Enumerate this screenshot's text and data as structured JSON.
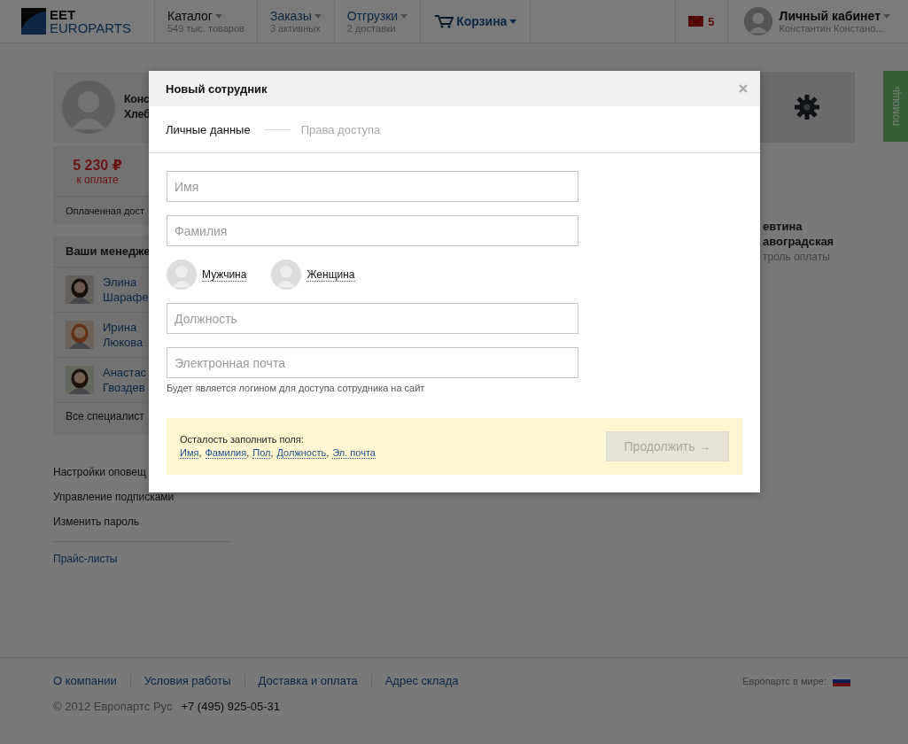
{
  "header": {
    "logo": {
      "top": "EET",
      "bottom": "EUROPARTS"
    },
    "nav": [
      {
        "kind": "menu",
        "label": "Каталог",
        "sub": "549 тыс. товаров",
        "accent": false
      },
      {
        "kind": "menu",
        "label": "Заказы",
        "sub": "3 активных",
        "accent": true
      },
      {
        "kind": "menu",
        "label": "Отгрузки",
        "sub": "2 доставки",
        "accent": true
      },
      {
        "kind": "cart",
        "label": "Корзина",
        "accent": true
      }
    ],
    "mail": {
      "count": "5"
    },
    "account": {
      "label": "Личный кабинет",
      "name": "Константин Констано..."
    }
  },
  "sidebar": {
    "profile": {
      "name_lines": [
        "Конс",
        "Хлеб"
      ],
      "amount": "5 230 ₽",
      "amount_label": "к оплате",
      "note": "Оплаченная дост"
    },
    "managers": {
      "title": "Ваши менедже",
      "people": [
        {
          "lines": [
            "Элина",
            "Шарафе"
          ]
        },
        {
          "lines": [
            "Ирина",
            "Люкова"
          ]
        },
        {
          "lines": [
            "Анастас",
            "Гвоздев"
          ]
        }
      ],
      "all": "Все специалист"
    },
    "links": [
      "Настройки оповещ",
      "Управление подписками",
      "Изменить пароль"
    ],
    "price_link": "Прайс-листы"
  },
  "right": {
    "person_lines": [
      "евтина",
      "авоградская"
    ],
    "role": "троль оплаты"
  },
  "help_tab": "помощь",
  "footer": {
    "links": [
      "О компании",
      "Условия работы",
      "Доставка и оплата",
      "Адрес склада"
    ],
    "copyright": "© 2012 Европартс Рус",
    "phone": "+7 (495) 925-05-31",
    "world_label": "Европартс в мире:"
  },
  "modal": {
    "title": "Новый сотрудник",
    "steps": [
      {
        "label": "Личные данные",
        "selected": true
      },
      {
        "label": "Права доступа",
        "selected": false
      }
    ],
    "fields": [
      {
        "kind": "input",
        "placeholder": "Имя"
      },
      {
        "kind": "input",
        "placeholder": "Фамилия"
      },
      {
        "kind": "gender",
        "options": [
          {
            "label": "Мужчина",
            "selected": false
          },
          {
            "label": "Женщина",
            "selected": false
          }
        ]
      },
      {
        "kind": "input",
        "placeholder": "Должность"
      },
      {
        "kind": "input",
        "placeholder": "Электронная почта",
        "hint": "Будет является логином для доступа сотрудника на сайт"
      }
    ],
    "notice": {
      "label": "Осталость заполнить поля:",
      "separator": ",",
      "missing": [
        "Имя",
        "Фамилия",
        "Пол",
        "Должность",
        "Эл. почта"
      ]
    },
    "button": {
      "label": "Продолжить →",
      "disabled": true
    }
  }
}
